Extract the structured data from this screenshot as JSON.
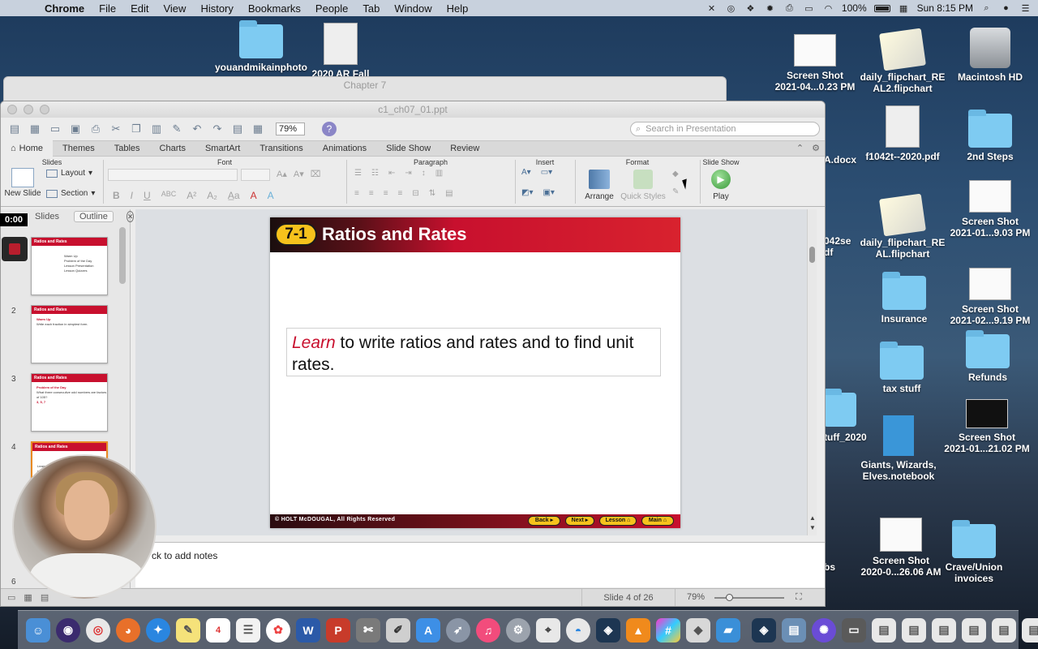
{
  "menubar": {
    "app_name": "Chrome",
    "items": [
      "File",
      "Edit",
      "View",
      "History",
      "Bookmarks",
      "People",
      "Tab",
      "Window",
      "Help"
    ],
    "battery": "100%",
    "clock": "Sun 8:15 PM"
  },
  "desktop": {
    "items": [
      {
        "label": "Screen Shot\n2021-04...0.23 PM",
        "icon": "screenshot-icon"
      },
      {
        "label": "daily_flipchart_RE\nAL2.flipchart",
        "icon": "flipchart-icon"
      },
      {
        "label": "Macintosh HD",
        "icon": "hard-drive-icon"
      },
      {
        "label": "A.docx",
        "icon": "document-icon"
      },
      {
        "label": "f1042t--2020.pdf",
        "icon": "pdf-icon"
      },
      {
        "label": "2nd Steps",
        "icon": "folder-icon"
      },
      {
        "label": "042se\ndf",
        "icon": "document-icon"
      },
      {
        "label": "daily_flipchart_RE\nAL.flipchart",
        "icon": "flipchart-icon"
      },
      {
        "label": "Screen Shot\n2021-01...9.03 PM",
        "icon": "screenshot-icon"
      },
      {
        "label": "Insurance",
        "icon": "folder-icon"
      },
      {
        "label": "Screen Shot\n2021-02...9.19 PM",
        "icon": "screenshot-icon"
      },
      {
        "label": "tax stuff",
        "icon": "folder-icon"
      },
      {
        "label": "Refunds",
        "icon": "folder-icon"
      },
      {
        "label": "tuff_2020",
        "icon": "folder-icon"
      },
      {
        "label": "Giants, Wizards,\nElves.notebook",
        "icon": "notebook-icon"
      },
      {
        "label": "Screen Shot\n2021-01...21.02 PM",
        "icon": "screenshot-icon"
      },
      {
        "label": "bs",
        "icon": "folder-icon"
      },
      {
        "label": "Screen Shot\n2020-0...26.06 AM",
        "icon": "screenshot-icon"
      },
      {
        "label": "Crave/Union\ninvoices",
        "icon": "folder-icon"
      },
      {
        "label": "youandmikainphoto",
        "icon": "folder-icon"
      },
      {
        "label": "2020 AR Fall",
        "icon": "pdf-icon"
      }
    ]
  },
  "back_window": {
    "title": "Chapter 7"
  },
  "ppt": {
    "doc_title": "c1_ch07_01.ppt",
    "zoom": "79%",
    "search_placeholder": "Search in Presentation",
    "tabs": [
      "Home",
      "Themes",
      "Tables",
      "Charts",
      "SmartArt",
      "Transitions",
      "Animations",
      "Slide Show",
      "Review"
    ],
    "groups": {
      "slides": "Slides",
      "font": "Font",
      "paragraph": "Paragraph",
      "insert": "Insert",
      "format": "Format",
      "slideshow": "Slide Show"
    },
    "buttons": {
      "new_slide": "New Slide",
      "layout": "Layout",
      "section": "Section",
      "arrange": "Arrange",
      "quick_styles": "Quick Styles",
      "play": "Play"
    },
    "pane_tabs": [
      "Slides",
      "Outline"
    ],
    "thumbnails": [
      {
        "num": "1",
        "header": "Ratios and Rates",
        "lines": [
          "Warm Up",
          "Problem of the Day",
          "Lesson Presentation",
          "Lesson Quizzes"
        ]
      },
      {
        "num": "2",
        "header": "Ratios and Rates",
        "lines": [
          "Warm Up",
          "Write each fraction in simplest form."
        ]
      },
      {
        "num": "3",
        "header": "Ratios and Rates",
        "lines": [
          "Problem of the Day",
          "What three consecutive odd numbers are factors of 105?",
          "3, 5, 7"
        ]
      },
      {
        "num": "4",
        "header": "Ratios and Rates",
        "lines": [
          "Learn to write ratios and rates and to find unit rates."
        ]
      },
      {
        "num": "6",
        "header": "",
        "lines": []
      }
    ],
    "slide": {
      "lesson_number": "7-1",
      "title": "Ratios and Rates",
      "objective_lead": "Learn",
      "objective_rest": " to write ratios and rates and to find unit rates.",
      "copyright": "© HOLT McDOUGAL, All Rights Reserved",
      "nav": [
        "Back",
        "Next",
        "Lesson",
        "Main"
      ]
    },
    "notes_placeholder": "ck to add notes",
    "status": {
      "slide_count": "Slide 4 of 26",
      "zoom": "79%"
    }
  },
  "recording": {
    "timer": "0:00"
  },
  "colors": {
    "slide_red": "#c8102e",
    "badge_yellow": "#f6c21c",
    "folder_blue": "#7ecbf2"
  }
}
